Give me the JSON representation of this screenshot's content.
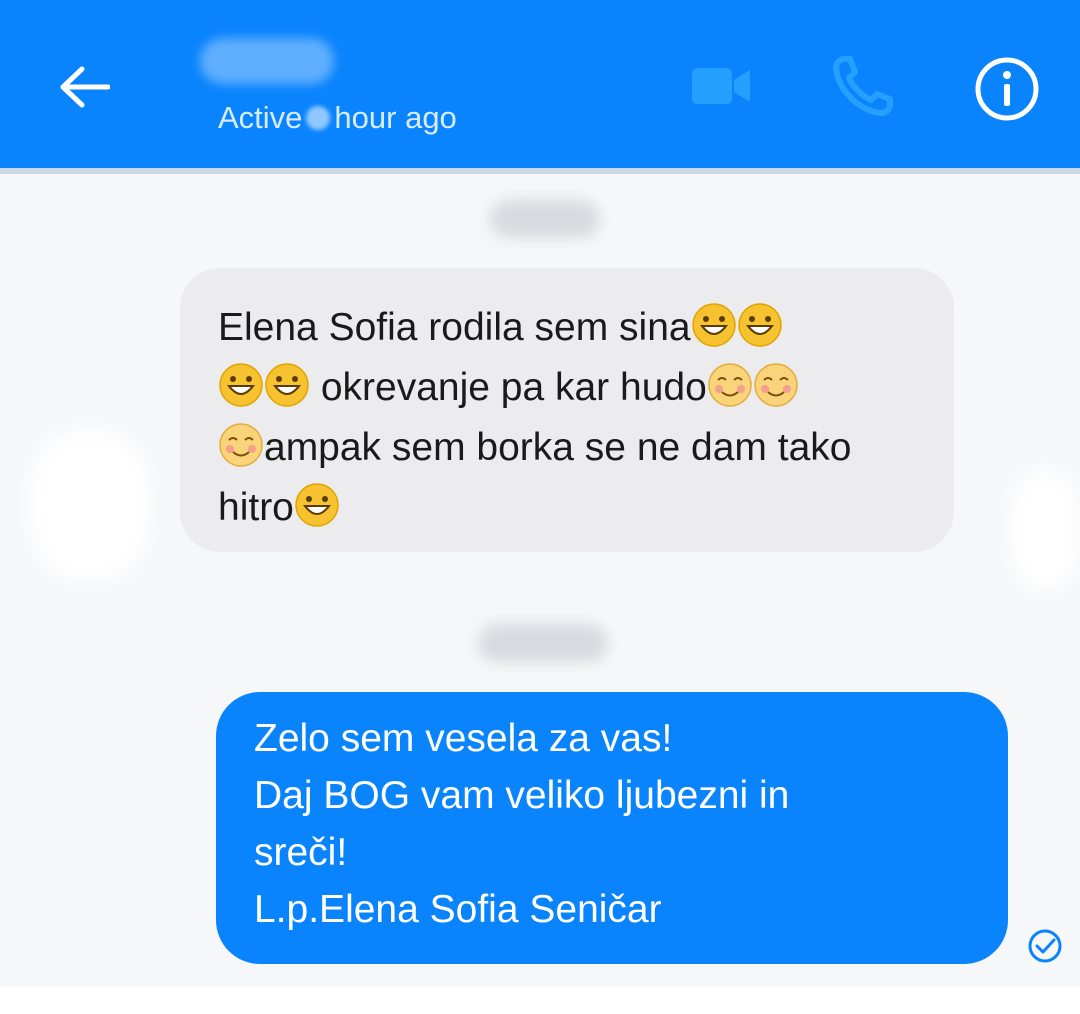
{
  "header": {
    "back_icon": "arrow-left-icon",
    "contact_name": "",
    "status_prefix": "Active",
    "status_suffix": "hour ago",
    "actions": [
      "video-camera-icon",
      "phone-icon",
      "info-icon"
    ],
    "background_color": "#0a84fd"
  },
  "messages": [
    {
      "direction": "incoming",
      "segments": [
        {
          "text": "Elena Sofia rodila sem sina"
        },
        {
          "emoji": "grinning-face"
        },
        {
          "emoji": "grinning-face"
        },
        {
          "emoji": "grinning-face"
        },
        {
          "emoji": "grinning-face"
        },
        {
          "text": " okrevanje pa kar hudo"
        },
        {
          "emoji": "smiling-blushing-face"
        },
        {
          "emoji": "smiling-blushing-face"
        },
        {
          "emoji": "smiling-blushing-face"
        },
        {
          "text": "ampak sem borka se ne dam tako hitro"
        },
        {
          "emoji": "grinning-face"
        }
      ]
    },
    {
      "direction": "outgoing",
      "lines": [
        "Zelo sem vesela za vas!",
        "Daj BOG vam veliko ljubezni in",
        "sreči!",
        "L.p.Elena Sofia Seničar"
      ],
      "status_icon": "seen-check-icon"
    }
  ],
  "colors": {
    "outgoing_bubble": "#0a84fd",
    "incoming_bubble": "#ececef",
    "chat_background": "#f6f7f9"
  }
}
